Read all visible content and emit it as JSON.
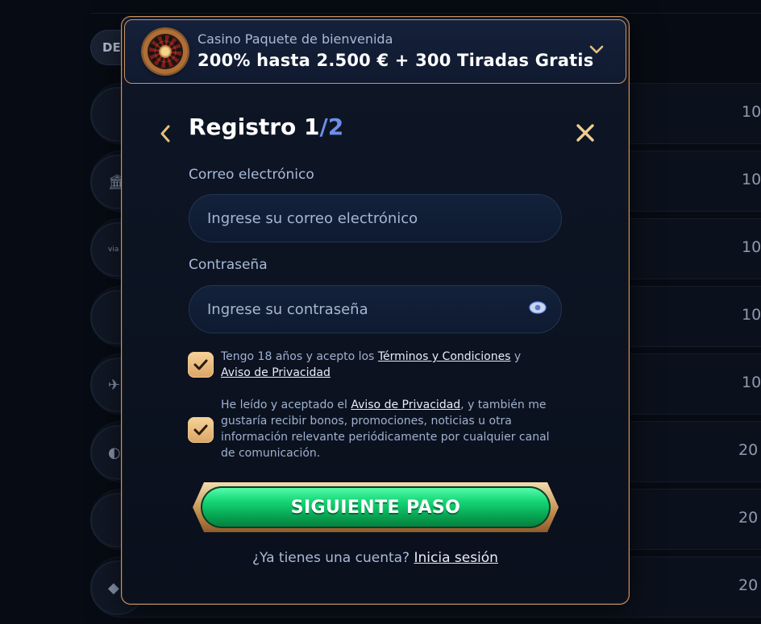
{
  "background": {
    "pill_label": "DE",
    "rows": [
      {
        "icon": "",
        "amount": "10"
      },
      {
        "icon": "🏛",
        "amount": "10"
      },
      {
        "icon": "via",
        "amount": "10"
      },
      {
        "icon": "",
        "amount": "10"
      },
      {
        "icon": "✈",
        "amount": "10"
      },
      {
        "icon": "◐",
        "amount": "20"
      },
      {
        "icon": "",
        "amount": "20"
      },
      {
        "icon": "◆",
        "amount": "20"
      }
    ]
  },
  "bonus": {
    "label": "Casino Paquete de bienvenida",
    "title": "200% hasta 2.500 € + 300 Tiradas Gratis",
    "icon": "roulette-icon"
  },
  "modal": {
    "title_main": "Registro 1",
    "title_total": "/2"
  },
  "email": {
    "label": "Correo electrónico",
    "placeholder": "Ingrese su correo electrónico",
    "value": ""
  },
  "password": {
    "label": "Contraseña",
    "placeholder": "Ingrese su contraseña",
    "value": ""
  },
  "consent1": {
    "prefix": "Tengo 18 años y acepto los ",
    "link1": "Términos y Condiciones",
    "middle": " y ",
    "link2": "Aviso de Privacidad",
    "checked": true
  },
  "consent2": {
    "prefix": "He leído y aceptado el ",
    "link": "Aviso de Privacidad",
    "suffix": ", y también me gustaría recibir bonos, promociones, noticias u otra información relevante periódicamente por cualquier canal de comunicación.",
    "checked": true
  },
  "cta": {
    "label": "SIGUIENTE PASO"
  },
  "login": {
    "prompt": "¿Ya tienes una cuenta? ",
    "link": "Inicia sesión"
  },
  "colors": {
    "accent_gold": "#c7956a",
    "accent_blue": "#6f8ee8",
    "cta_green": "#16d777",
    "background": "#070b13"
  }
}
